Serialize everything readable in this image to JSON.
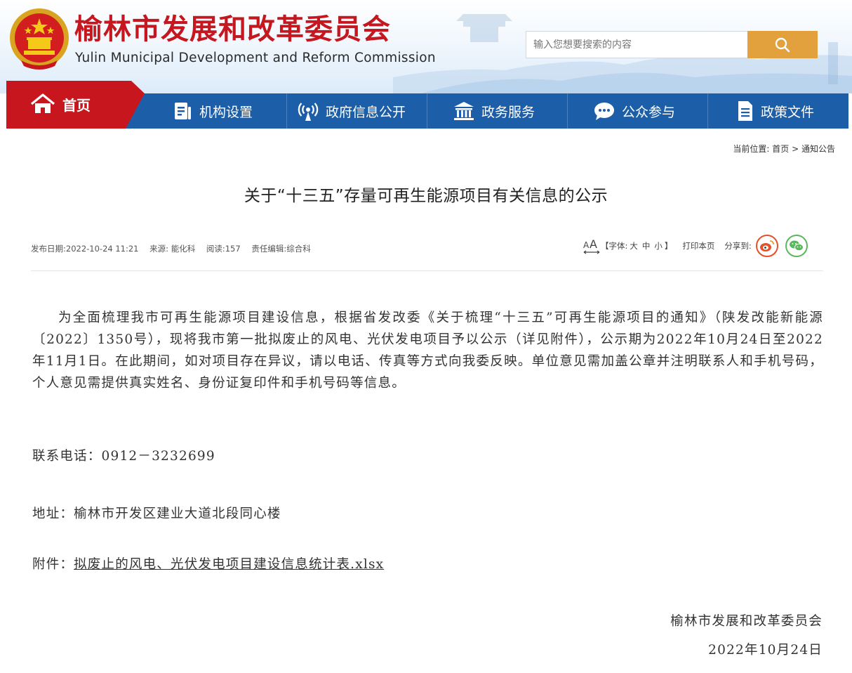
{
  "header": {
    "title_cn": "榆林市发展和改革委员会",
    "title_en": "Yulin Municipal Development and Reform Commission",
    "search_placeholder": "输入您想要搜索的内容",
    "brand_red": "#c8161e",
    "nav_blue": "#1c5ea8",
    "search_orange": "#e2a13c"
  },
  "nav": {
    "home": "首页",
    "items": [
      "机构设置",
      "政府信息公开",
      "政务服务",
      "公众参与",
      "政策文件"
    ]
  },
  "breadcrumb": {
    "prefix": "当前位置:",
    "home": "首页",
    "sep": ">",
    "current": "通知公告"
  },
  "article": {
    "title": "关于“十三五”存量可再生能源项目有关信息的公示",
    "meta": {
      "date": "发布日期:2022-10-24 11:21",
      "source": "来源: 能化科",
      "views": "阅读:157",
      "editor": "责任编辑:综合科"
    },
    "tools": {
      "font_label": "【字体:",
      "font_large": "大",
      "font_mid": "中",
      "font_small": "小",
      "font_close": "】",
      "print": "打印本页",
      "share": "分享到:"
    },
    "paragraph": "为全面梳理我市可再生能源项目建设信息，根据省发改委《关于梳理“十三五”可再生能源项目的通知》（陕发改能新能源〔2022〕1350号），现将我市第一批拟废止的风电、光伏发电项目予以公示（详见附件），公示期为2022年10月24日至2022年11月1日。在此期间，如对项目存在异议，请以电话、传真等方式向我委反映。单位意见需加盖公章并注明联系人和手机号码，个人意见需提供真实姓名、身份证复印件和手机号码等信息。",
    "phone": "联系电话：0912－3232699",
    "address": "地址：榆林市开发区建业大道北段同心楼",
    "attachment_label": "附件：",
    "attachment_link": "拟废止的风电、光伏发电项目建设信息统计表.xlsx",
    "sign_org": "榆林市发展和改革委员会",
    "sign_date": "2022年10月24日"
  }
}
